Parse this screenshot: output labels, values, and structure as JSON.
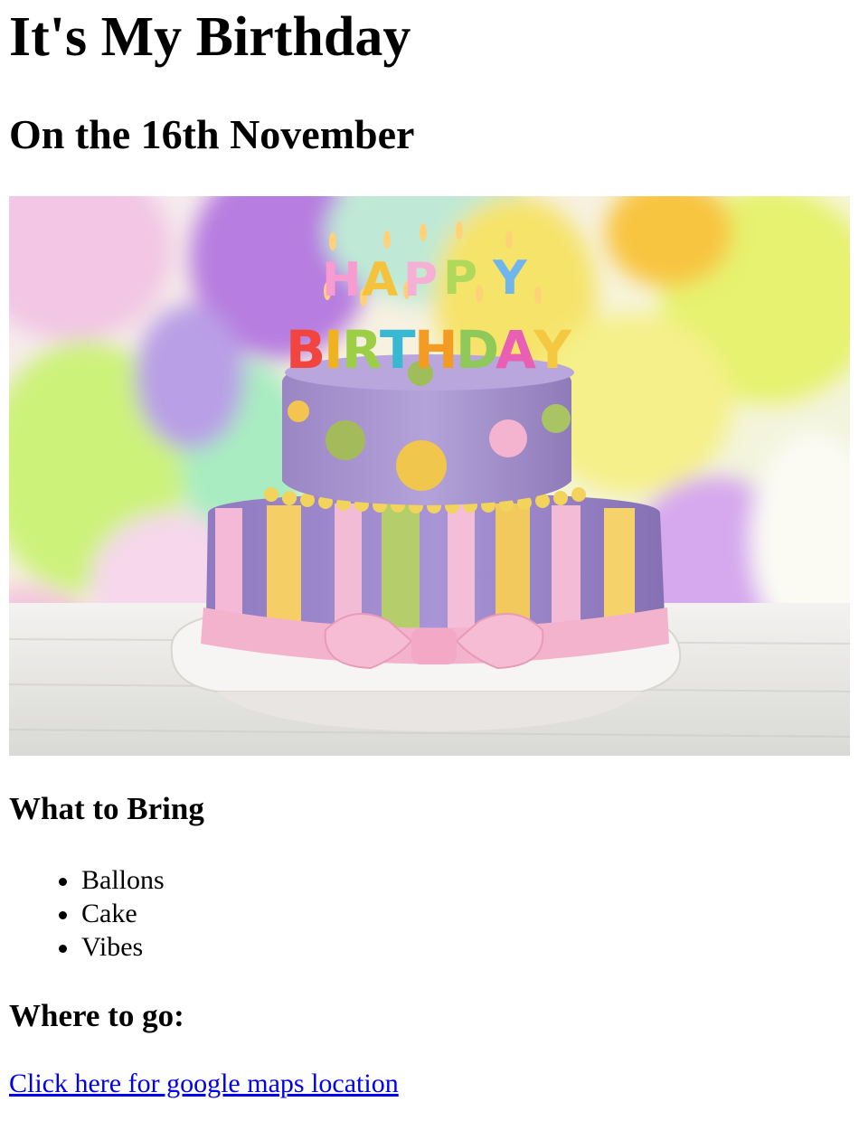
{
  "page": {
    "title": "It's My Birthday",
    "subtitle": "On the 16th November"
  },
  "hero": {
    "icon": "birthday-cake-image",
    "cake_topper_text": [
      "HAPPY",
      "BIRTHDAY"
    ]
  },
  "bring": {
    "heading": "What to Bring",
    "items": [
      "Ballons",
      "Cake",
      "Vibes"
    ]
  },
  "where": {
    "heading": "Where to go:",
    "link_label": "Click here for google maps location",
    "link_color": "#0000ee"
  }
}
